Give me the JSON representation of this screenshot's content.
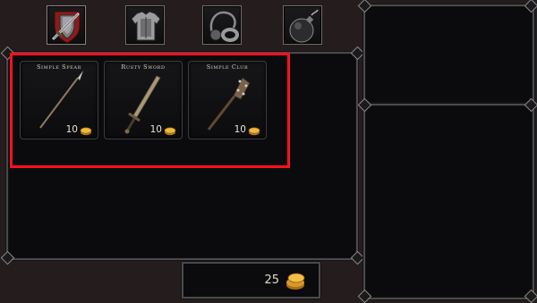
{
  "tabs": [
    {
      "name": "weapons",
      "icon": "shield-sword-icon",
      "active": true
    },
    {
      "name": "armor",
      "icon": "chest-armor-icon",
      "active": false
    },
    {
      "name": "accessories",
      "icon": "ring-amulet-icon",
      "active": false
    },
    {
      "name": "consumables",
      "icon": "bomb-icon",
      "active": false
    }
  ],
  "shop": {
    "items": [
      {
        "name": "Simple Spear",
        "price": "10",
        "icon": "spear-icon"
      },
      {
        "name": "Rusty Sword",
        "price": "10",
        "icon": "sword-icon"
      },
      {
        "name": "Simple Club",
        "price": "10",
        "icon": "club-icon"
      }
    ]
  },
  "player": {
    "gold": "25"
  },
  "colors": {
    "highlight": "#ff1020",
    "gold": "#e1a52c",
    "frame": "#4a4a4c"
  }
}
